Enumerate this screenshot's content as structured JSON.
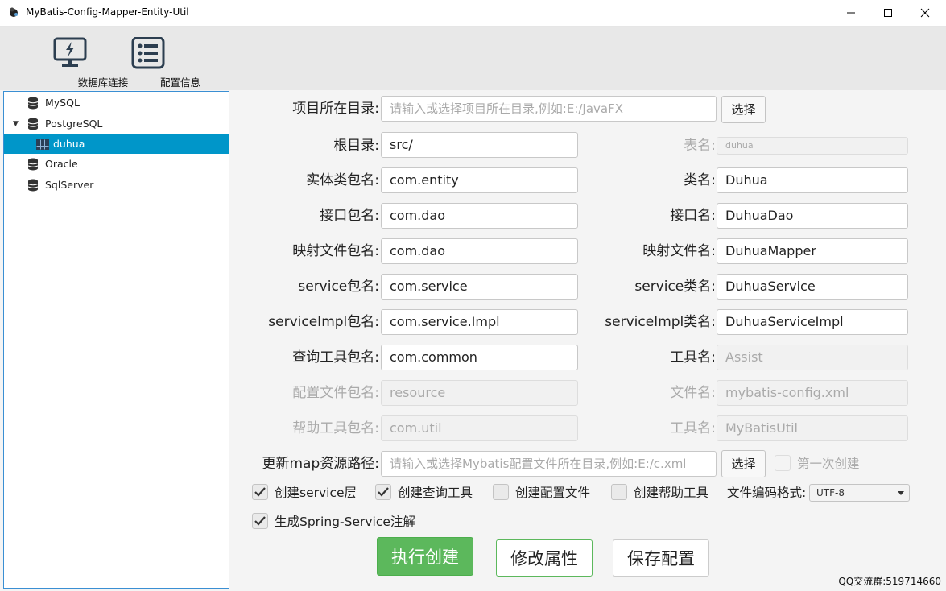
{
  "window": {
    "title": "MyBatis-Config-Mapper-Entity-Util"
  },
  "toolbar": {
    "db_connect": "数据库连接",
    "config_info": "配置信息"
  },
  "tree": {
    "items": [
      {
        "label": "MySQL",
        "icon": "database-icon"
      },
      {
        "label": "PostgreSQL",
        "icon": "database-icon",
        "expanded": true
      },
      {
        "label": "duhua",
        "icon": "table-icon",
        "selected": true
      },
      {
        "label": "Oracle",
        "icon": "database-icon"
      },
      {
        "label": "SqlServer",
        "icon": "database-icon"
      }
    ]
  },
  "form": {
    "project_dir": {
      "label": "项目所在目录:",
      "placeholder": "请输入或选择项目所在目录,例如:E:/JavaFX",
      "button": "选择"
    },
    "root_dir": {
      "label": "根目录:",
      "value": "src/"
    },
    "table_name": {
      "label": "表名:",
      "value": "duhua"
    },
    "entity_pkg": {
      "label": "实体类包名:",
      "value": "com.entity"
    },
    "class_name": {
      "label": "类名:",
      "value": "Duhua"
    },
    "dao_pkg": {
      "label": "接口包名:",
      "value": "com.dao"
    },
    "dao_name": {
      "label": "接口名:",
      "value": "DuhuaDao"
    },
    "mapper_pkg": {
      "label": "映射文件包名:",
      "value": "com.dao"
    },
    "mapper_name": {
      "label": "映射文件名:",
      "value": "DuhuaMapper"
    },
    "service_pkg": {
      "label": "service包名:",
      "value": "com.service"
    },
    "service_name": {
      "label": "service类名:",
      "value": "DuhuaService"
    },
    "serviceimpl_pkg": {
      "label": "serviceImpl包名:",
      "value": "com.service.Impl"
    },
    "serviceimpl_name": {
      "label": "serviceImpl类名:",
      "value": "DuhuaServiceImpl"
    },
    "query_pkg": {
      "label": "查询工具包名:",
      "value": "com.common"
    },
    "tool_name": {
      "label": "工具名:",
      "value": "Assist"
    },
    "config_pkg": {
      "label": "配置文件包名:",
      "value": "resource"
    },
    "file_name": {
      "label": "文件名:",
      "value": "mybatis-config.xml"
    },
    "helper_pkg": {
      "label": "帮助工具包名:",
      "value": "com.util"
    },
    "helper_name": {
      "label": "工具名:",
      "value": "MyBatisUtil"
    },
    "map_path": {
      "label": "更新map资源路径:",
      "placeholder": "请输入或选择Mybatis配置文件所在目录,例如:E:/c.xml",
      "button": "选择",
      "first_create": "第一次创建"
    }
  },
  "options": {
    "create_service": "创建service层",
    "create_query_tool": "创建查询工具",
    "create_config_file": "创建配置文件",
    "create_helper_tool": "创建帮助工具",
    "encoding_label": "文件编码格式:",
    "encoding_value": "UTF-8",
    "spring_annotation": "生成Spring-Service注解"
  },
  "actions": {
    "execute": "执行创建",
    "modify": "修改属性",
    "save": "保存配置"
  },
  "status": {
    "qq": "QQ交流群:519714660"
  },
  "colors": {
    "accent": "#0096c9",
    "execute_bg": "#5cb85c",
    "modify_border": "#5cb85c"
  }
}
